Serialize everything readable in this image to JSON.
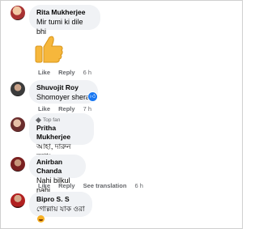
{
  "comments": [
    {
      "name": "Rita Mukherjee",
      "text": "Mir tumi ki dile bhi",
      "actions": {
        "like": "Like",
        "reply": "Reply",
        "time": "6 h"
      }
    },
    {
      "name": "Shuvojit Roy",
      "text": "Shomoyer shera",
      "actions": {
        "like": "Like",
        "reply": "Reply",
        "time": "7 h"
      }
    },
    {
      "name": "Pritha Mukherjee",
      "badge": "Top fan",
      "text": "আহা, দারুন কথা।"
    },
    {
      "name": "Anirban Chanda",
      "text": "Nahi bilkul nahi",
      "actions": {
        "like": "Like",
        "reply": "Reply",
        "translation": "See translation",
        "time": "6 h"
      }
    },
    {
      "name": "Bipro S. S",
      "text": "গোল্লায় যাক ওরা"
    }
  ],
  "icons": {
    "thumbs_up_sticker": "thumbs-up-icon",
    "like_reaction": "like-reaction-icon",
    "haha_reaction": "haha-emoji-icon",
    "top_fan_badge": "top-fan-icon"
  },
  "colors": {
    "bubble": "#f0f2f5",
    "meta_text": "#65676b",
    "like_blue": "#1877f2",
    "thumb_yellow": "#f6b73c"
  }
}
